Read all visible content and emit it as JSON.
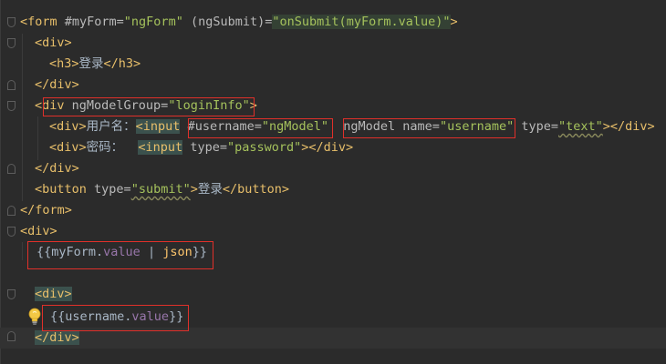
{
  "code": {
    "l1": {
      "open_tag": "<form",
      "attr_ref": " #myForm=",
      "ref_val": "\"ngForm\"",
      "event_attr": " (ngSubmit)=",
      "q_open": "\"",
      "handler": "onSubmit",
      "paren_open": "(",
      "obj": "myForm.",
      "prop": "value",
      "paren_close": ")",
      "q_close": "\"",
      "end": ">"
    },
    "l2": {
      "tag": "<div>"
    },
    "l3": {
      "open": "<h3>",
      "text": "登录",
      "close": "</h3>"
    },
    "l4": {
      "tag": "</div>"
    },
    "l5": {
      "open": "<div ",
      "attr": "ngModelGroup=",
      "val": "\"loginInfo\"",
      "end": ">"
    },
    "l6": {
      "div_open": "<div>",
      "label": "用户名：",
      "input_open": "<input",
      "space1": " ",
      "ref_attr": "#username=",
      "ref_val": "\"ngModel\"",
      "space2": "  ",
      "model_attr": "ngModel name=",
      "name_val": "\"username\"",
      "type_attr": " type=",
      "type_val": "\"text\"",
      "close": "></div>"
    },
    "l7": {
      "div_open": "<div>",
      "label": "密码：  ",
      "input_open": "<input",
      "type_attr": " type=",
      "type_val": "\"password\"",
      "close": "></div>"
    },
    "l8": {
      "tag": "</div>"
    },
    "l9": {
      "open": "<button",
      "attr": " type=",
      "val": "\"submit\"",
      "gt": ">",
      "text": "登录",
      "close": "</button>"
    },
    "l10": {
      "tag": "</form>"
    },
    "l11": {
      "tag": "<div>"
    },
    "l12": {
      "open": "{{",
      "obj": "myForm.",
      "prop": "value",
      "pipe": " | ",
      "fn": "json",
      "close": "}}"
    },
    "l14": {
      "tag": "<div>"
    },
    "l15": {
      "open": "{{",
      "obj": "username.",
      "prop": "value",
      "close": "}}"
    },
    "l16": {
      "tag": "</div>"
    }
  },
  "colors": {
    "background": "#2b2b2b",
    "tag": "#e8bf6a",
    "string": "#a5c25c",
    "annotation_box": "#e0302a"
  },
  "icons": {
    "intention_bulb": "lightbulb-icon"
  }
}
